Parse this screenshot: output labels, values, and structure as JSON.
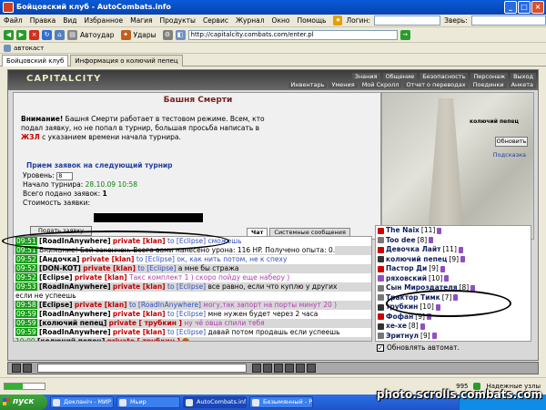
{
  "window": {
    "title": "Бойцовский клуб - AutoCombats.info"
  },
  "menu": {
    "items": [
      "Файл",
      "Правка",
      "Вид",
      "Избранное",
      "Магия",
      "Продукты",
      "Сервис",
      "Журнал",
      "Окно",
      "Помощь"
    ],
    "login_label": "Логин:",
    "beast_label": "Зверь:"
  },
  "toolbar": {
    "autoattack": "Автоудар",
    "hits": "Удары",
    "address": "http://capitalcity.combats.com/enter.pl"
  },
  "favbar": {
    "item": "автокаст"
  },
  "tabs": [
    {
      "label": "Бойцовский клуб"
    },
    {
      "label": "Информация о колючий пепец"
    }
  ],
  "game": {
    "logo": "CAPITALCITY",
    "nav_top": [
      "Знания",
      "Общение",
      "Безопасность",
      "Персонаж",
      "Выход"
    ],
    "nav_bottom": [
      "Инвентарь",
      "Умения",
      "Мой Скролл",
      "Отчет о переводах",
      "Поединки",
      "Анкета"
    ],
    "sidebar_user": "колючий пепец",
    "panel": {
      "title": "Башня Смерти",
      "warn_strong": "Внимание!",
      "warn_1": " Башня Смерти работает в тестовом режиме. Всем, кто подал заявку, но не попал в турнир, большая просьба написать в ",
      "warn_link": "ЖЗЛ",
      "warn_2": " с указанием времени начала турнира.",
      "recv_title": "Прием заявок на следующий турнир",
      "level_label": "Уровень:",
      "level_value": "8",
      "start_label": "Начало турнира:",
      "start_value": "28.10.09 10:58",
      "total_label": "Всего подано заявок:",
      "total_value": "1",
      "cost_label": "Стоимость заявки:",
      "submit": "Подать заявку"
    },
    "refresh": "Обновить",
    "hint": "Подсказка",
    "chat_tabs": [
      "Чат",
      "Системные сообщения"
    ],
    "chat": [
      {
        "t": "09:51",
        "style": "tm",
        "nm": "[RoadInAnywhere]",
        "pv": "private [klan]",
        "to": "to [Eclipse]",
        "msg": "сможешь",
        "mc": "msg"
      },
      {
        "t": "09:51",
        "style": "tm",
        "nm": "",
        "pv": "",
        "to": "",
        "msg": "Внимание! Бой закончен. Всего вами нанесено урона: 116 HP. Получено опыта: 0.",
        "mc": "sys"
      },
      {
        "t": "09:52",
        "style": "tm",
        "nm": "[Андочка]",
        "pv": "private [klan]",
        "to": "to [Eclipse]",
        "msg": "ок, как нить потом, не к спеху",
        "mc": "msg"
      },
      {
        "t": "09:52",
        "style": "tm",
        "nm": "[DON-KOT]",
        "pv": "private [klan]",
        "to": "to [Eclipse]",
        "msg": "а мне бы стража",
        "mc": "blk"
      },
      {
        "t": "09:52",
        "style": "tm",
        "nm": "[Eclipse]",
        "pv": "private [klan]",
        "to": "",
        "msg": "Такс комплект 1 ) скоро пойду еще наберу )",
        "mc": "msgp"
      },
      {
        "t": "09:53",
        "style": "tm",
        "nm": "[RoadInAnywhere]",
        "pv": "private [klan]",
        "to": "to [Eclipse]",
        "msg": "все равно, если что куплю у других",
        "mc": "blk"
      },
      {
        "t": "",
        "style": "none",
        "nm": "",
        "pv": "",
        "to": "",
        "msg": "если не успеешь",
        "mc": "blk"
      },
      {
        "t": "09:58",
        "style": "tm",
        "nm": "[Eclipse]",
        "pv": "private [klan]",
        "to": "to [RoadInAnywhere]",
        "msg": "могу,так запорт на порты минут 20 )",
        "mc": "msgp"
      },
      {
        "t": "09:59",
        "style": "tm",
        "nm": "[RoadInAnywhere]",
        "pv": "private [klan]",
        "to": "to [Eclipse]",
        "msg": "мне нужен будет через 2 часа",
        "mc": "blk"
      },
      {
        "t": "09:59",
        "style": "tm",
        "nm": "[колючий пепец]",
        "pv": "private [ трубкин ]",
        "to": "",
        "msg": "ну чё овца спили тебя",
        "mc": "msgp"
      },
      {
        "t": "09:59",
        "style": "tm",
        "nm": "[RoadInAnywhere]",
        "pv": "private [klan]",
        "to": "to [Eclipse]",
        "msg": "давай потом продашь если успеешь",
        "mc": "blk"
      },
      {
        "t": "10:00",
        "style": "tmg",
        "nm": "[колючий пепец]",
        "pv": "private [ трубкин ]",
        "to": "",
        "msg": "",
        "mc": "blk",
        "smile": "red"
      },
      {
        "t": "10:00",
        "style": "tmg",
        "nm": "[Lilu]",
        "pv": "",
        "to": "to [ T a i g a ]",
        "msg": "",
        "mc": "blk",
        "smile": "yellow"
      },
      {
        "t": "10:00",
        "style": "tmg",
        "nm": "[Eclipse]",
        "pv": "private [klan]",
        "to": "to [RoadInAnywhere]",
        "msg": "Злод? какие статы?",
        "mc": "msgp"
      }
    ],
    "users": [
      {
        "name": "The Naix",
        "lvl": "[11]",
        "icon": "r"
      },
      {
        "name": "Too dee",
        "lvl": "[8]",
        "icon": "g"
      },
      {
        "name": "Девочка Лайт",
        "lvl": "[11]",
        "icon": "r"
      },
      {
        "name": "колючий пепец",
        "lvl": "[9]",
        "icon": "d"
      },
      {
        "name": "Пастор Ди",
        "lvl": "[9]",
        "icon": "r"
      },
      {
        "name": "ряховский",
        "lvl": "[10]",
        "icon": "p"
      },
      {
        "name": "Сын Мироздателя",
        "lvl": "[8]",
        "icon": "g"
      },
      {
        "name": "Трактор Тимк",
        "lvl": "[7]",
        "icon": "g"
      },
      {
        "name": "трубкин",
        "lvl": "[10]",
        "icon": "d"
      },
      {
        "name": "Фофан",
        "lvl": "[9]",
        "icon": "r"
      },
      {
        "name": "хе-хе",
        "lvl": "[8]",
        "icon": "d"
      },
      {
        "name": "Эритнул",
        "lvl": "[9]",
        "icon": "g"
      }
    ],
    "auto_update": "Обновлять автомат."
  },
  "status": {
    "progress": 0.45,
    "count": "995",
    "zone": "Надежные узлы"
  },
  "taskbar": {
    "start": "пуск",
    "tasks": [
      "Декланіч - МИР - Opera",
      "Мьир",
      "AutoCombats.info",
      "Безымянный - Paint"
    ],
    "active_index": 2
  },
  "watermark": "photo.scrolls.combats.com"
}
